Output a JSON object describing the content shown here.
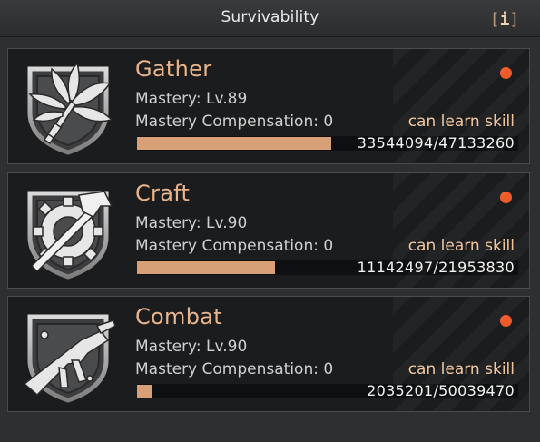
{
  "header": {
    "title": "Survivability",
    "info_label": "i"
  },
  "colors": {
    "accent": "#e9b48b",
    "progress": "#d8a077",
    "notification": "#f05a2a"
  },
  "skills": [
    {
      "name": "Gather",
      "icon": "leaf-bundle-icon",
      "mastery": "Mastery: Lv.89",
      "compensation": "Mastery Compensation: 0",
      "status": "can learn skill",
      "exp_text": "33544094/47133260",
      "exp_current": 33544094,
      "exp_max": 47133260,
      "has_alert": true
    },
    {
      "name": "Craft",
      "icon": "hammer-gear-icon",
      "mastery": "Mastery: Lv.90",
      "compensation": "Mastery Compensation: 0",
      "status": "can learn skill",
      "exp_text": "11142497/21953830",
      "exp_current": 11142497,
      "exp_max": 21953830,
      "has_alert": true
    },
    {
      "name": "Combat",
      "icon": "submachine-gun-icon",
      "mastery": "Mastery: Lv.90",
      "compensation": "Mastery Compensation: 0",
      "status": "can learn skill",
      "exp_text": "2035201/50039470",
      "exp_current": 2035201,
      "exp_max": 50039470,
      "has_alert": true
    }
  ]
}
